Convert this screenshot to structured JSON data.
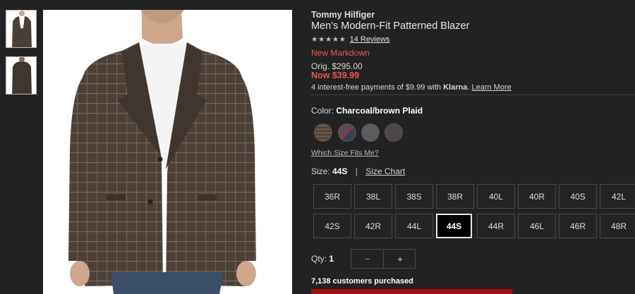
{
  "product": {
    "brand": "Tommy Hilfiger",
    "title": "Men's Modern-Fit Patterned Blazer",
    "stars": "★★★★★",
    "rating": 5,
    "reviews_label": "14 Reviews",
    "markdown_label": "New Markdown",
    "orig_price": "Orig. $295.00",
    "now_price": "Now $39.99",
    "klarna": {
      "text": "4 interest-free payments of $9.99 with",
      "brand": "Klarna",
      "suffix": ".",
      "learn_more": "Learn More"
    }
  },
  "color": {
    "label": "Color:",
    "selected": "Charcoal/brown Plaid",
    "swatches": [
      "brown-plaid-swatch",
      "navy-red-plaid-swatch",
      "grey-swatch",
      "charcoal-swatch"
    ]
  },
  "fit_link": "Which Size Fits Me?",
  "size": {
    "label": "Size:",
    "selected": "44S",
    "separator": "|",
    "chart_link": "Size Chart",
    "row1": [
      "36R",
      "38L",
      "38S",
      "38R",
      "40L",
      "40R",
      "40S",
      "42L"
    ],
    "row2": [
      "42S",
      "42R",
      "44L",
      "44S",
      "44R",
      "46L",
      "46R",
      "48R"
    ]
  },
  "quantity": {
    "label": "Qty:",
    "value": "1",
    "minus": "−",
    "plus": "+"
  },
  "social_proof": "7,138 customers purchased",
  "colors": {
    "background": "#222222",
    "sale_red": "#ee5555",
    "cta_red": "#a31010"
  }
}
